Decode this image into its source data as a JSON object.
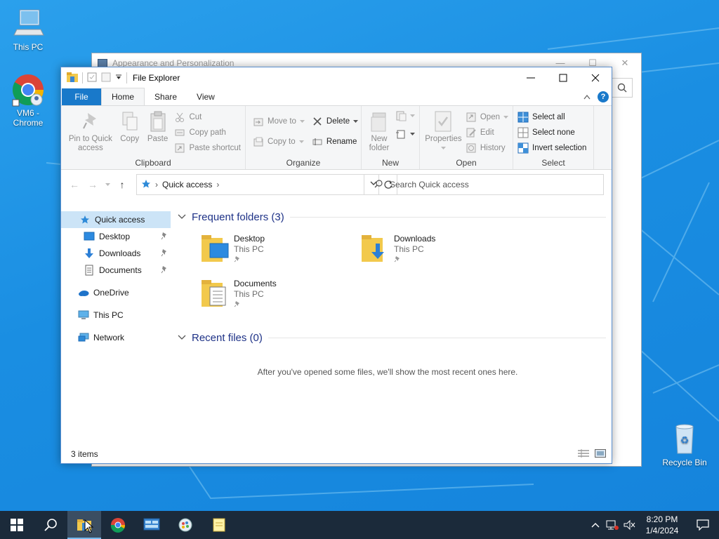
{
  "desktop": {
    "icons": [
      {
        "label": "This PC"
      },
      {
        "label": "VM6 -\nChrome",
        "line1": "VM6 -",
        "line2": "Chrome"
      },
      {
        "label": "Recycle Bin"
      }
    ]
  },
  "background_window": {
    "title": "Appearance and Personalization"
  },
  "explorer": {
    "title": "File Explorer",
    "tabs": [
      {
        "label": "File"
      },
      {
        "label": "Home"
      },
      {
        "label": "Share"
      },
      {
        "label": "View"
      }
    ],
    "ribbon": {
      "clipboard": {
        "label": "Clipboard",
        "pin_line1": "Pin to Quick",
        "pin_line2": "access",
        "copy": "Copy",
        "paste": "Paste",
        "cut": "Cut",
        "copy_path": "Copy path",
        "paste_shortcut": "Paste shortcut"
      },
      "organize": {
        "label": "Organize",
        "move_to": "Move to",
        "copy_to": "Copy to",
        "delete": "Delete",
        "rename": "Rename"
      },
      "new": {
        "label": "New",
        "new_folder_line1": "New",
        "new_folder_line2": "folder"
      },
      "open": {
        "label": "Open",
        "properties": "Properties",
        "open": "Open",
        "edit": "Edit",
        "history": "History"
      },
      "select": {
        "label": "Select",
        "select_all": "Select all",
        "select_none": "Select none",
        "invert_selection": "Invert selection"
      }
    },
    "address": {
      "path": "Quick access",
      "search_placeholder": "Search Quick access"
    },
    "nav": {
      "quick_access": "Quick access",
      "desktop": "Desktop",
      "downloads": "Downloads",
      "documents": "Documents",
      "onedrive": "OneDrive",
      "this_pc": "This PC",
      "network": "Network"
    },
    "frequent": {
      "heading": "Frequent folders (3)",
      "items": [
        {
          "name": "Desktop",
          "location": "This PC"
        },
        {
          "name": "Downloads",
          "location": "This PC"
        },
        {
          "name": "Documents",
          "location": "This PC"
        }
      ]
    },
    "recent": {
      "heading": "Recent files (0)",
      "empty_message": "After you've opened some files, we'll show the most recent ones here."
    },
    "status": "3 items"
  },
  "taskbar": {
    "time": "8:20 PM",
    "date": "1/4/2024"
  },
  "colors": {
    "accent": "#1979ca",
    "selection": "#cce4f7",
    "heading": "#1e3287",
    "taskbar": "#1b2a3a"
  }
}
